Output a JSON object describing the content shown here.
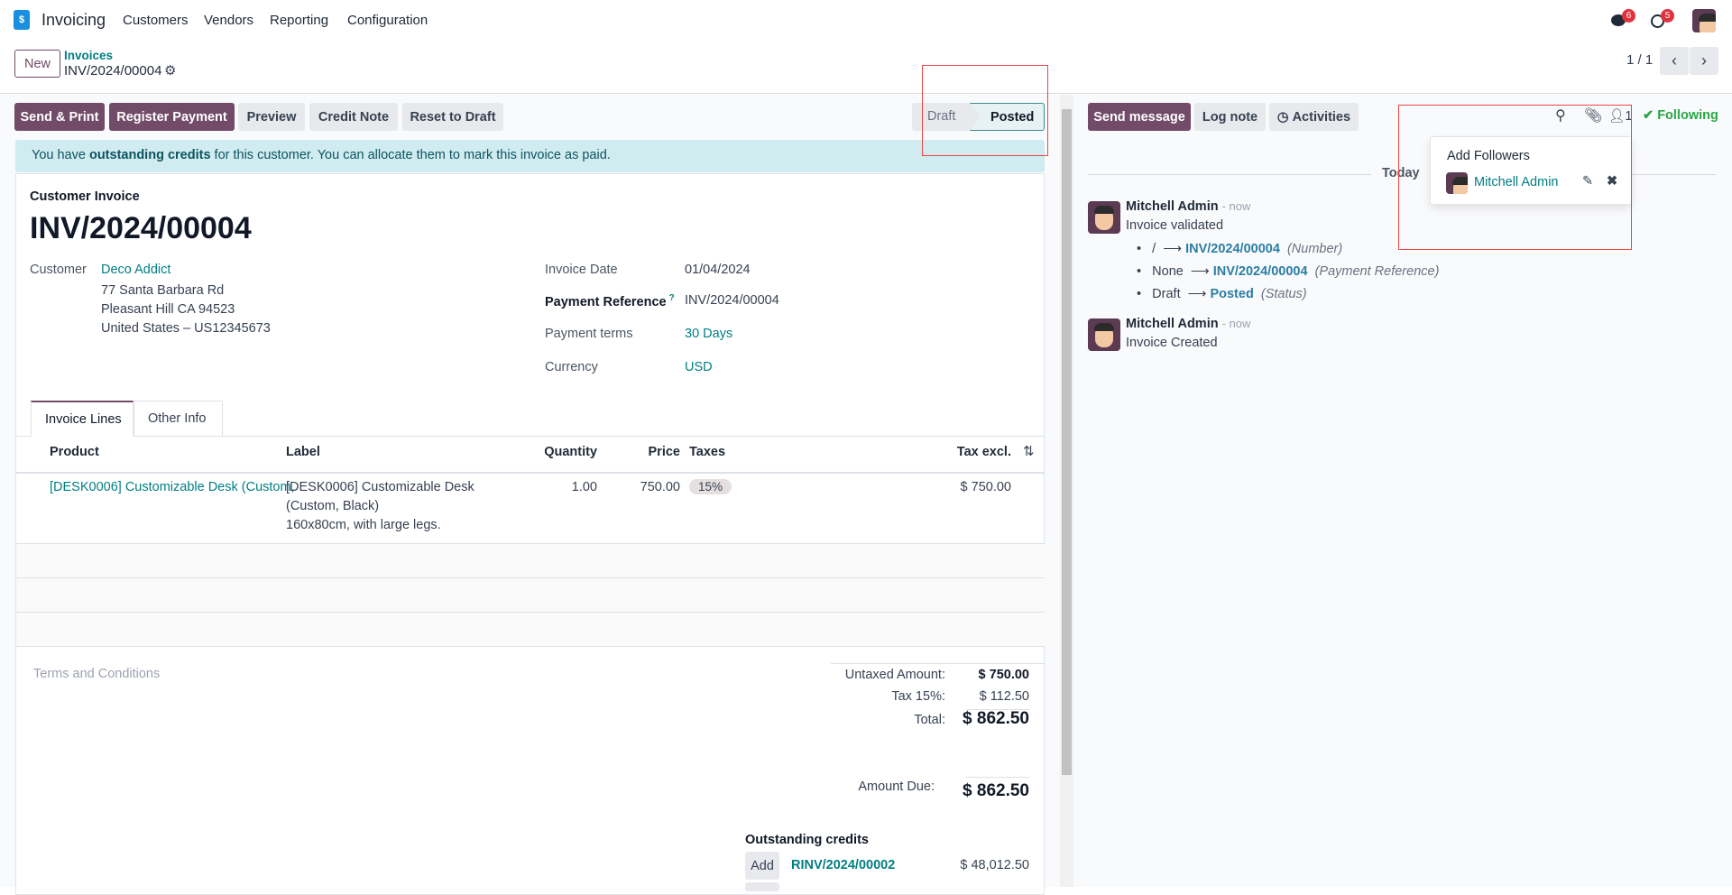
{
  "navbar": {
    "app": "Invoicing",
    "menu": [
      "Customers",
      "Vendors",
      "Reporting",
      "Configuration"
    ],
    "messages_badge": "6",
    "activities_badge": "5"
  },
  "control": {
    "new": "New",
    "breadcrumb_parent": "Invoices",
    "breadcrumb_current": "INV/2024/00004",
    "pager": "1 / 1"
  },
  "actions": {
    "send_print": "Send & Print",
    "register_payment": "Register Payment",
    "preview": "Preview",
    "credit_note": "Credit Note",
    "reset": "Reset to Draft"
  },
  "status": {
    "draft": "Draft",
    "posted": "Posted",
    "current": "Posted"
  },
  "alert": {
    "pre": "You have ",
    "bold": "outstanding credits",
    "post": " for this customer. You can allocate them to mark this invoice as paid."
  },
  "form": {
    "type": "Customer Invoice",
    "number": "INV/2024/00004",
    "customer_label": "Customer",
    "customer": "Deco Addict",
    "address": [
      "77 Santa Barbara Rd",
      "Pleasant Hill CA 94523",
      "United States – US12345673"
    ],
    "invoice_date_label": "Invoice Date",
    "invoice_date": "01/04/2024",
    "payment_ref_label": "Payment Reference",
    "payment_ref_help": "?",
    "payment_ref": "INV/2024/00004",
    "payment_terms_label": "Payment terms",
    "payment_terms": "30 Days",
    "currency_label": "Currency",
    "currency": "USD"
  },
  "tabs": [
    "Invoice Lines",
    "Other Info"
  ],
  "table": {
    "headers": {
      "product": "Product",
      "label": "Label",
      "quantity": "Quantity",
      "price": "Price",
      "taxes": "Taxes",
      "tax_excl": "Tax excl."
    },
    "rows": [
      {
        "product": "[DESK0006] Customizable Desk (Custom,",
        "label": [
          "[DESK0006] Customizable Desk",
          "(Custom, Black)",
          "160x80cm, with large legs."
        ],
        "quantity": "1.00",
        "price": "750.00",
        "tax": "15%",
        "subtotal": "$ 750.00"
      }
    ]
  },
  "terms_placeholder": "Terms and Conditions",
  "totals": {
    "untaxed_label": "Untaxed Amount:",
    "untaxed": "$ 750.00",
    "tax_label": "Tax 15%:",
    "tax": "$ 112.50",
    "total_label": "Total:",
    "total": "$ 862.50",
    "due_label": "Amount Due:",
    "due": "$ 862.50"
  },
  "credits": {
    "title": "Outstanding credits",
    "add": "Add",
    "ref": "RINV/2024/00002",
    "amount": "$ 48,012.50"
  },
  "chatter": {
    "send_message": "Send message",
    "log_note": "Log note",
    "activities": "Activities",
    "followers_count": "1",
    "following": "Following",
    "popup": {
      "title": "Add Followers",
      "follower": "Mitchell Admin"
    },
    "today": "Today",
    "messages": [
      {
        "author": "Mitchell Admin",
        "time": "- now",
        "body": "Invoice validated",
        "changes": [
          {
            "old": "/",
            "new": "INV/2024/00004",
            "field": "(Number)"
          },
          {
            "old": "None",
            "new": "INV/2024/00004",
            "field": "(Payment Reference)"
          },
          {
            "old": "Draft",
            "new": "Posted",
            "field": "(Status)"
          }
        ]
      },
      {
        "author": "Mitchell Admin",
        "time": "- now",
        "body": "Invoice Created"
      }
    ]
  },
  "colors": {
    "primary": "#714B67",
    "link": "#017E84",
    "following": "#28a745",
    "alert_bg": "#d1ecf1",
    "annotation": "#ef4444"
  }
}
